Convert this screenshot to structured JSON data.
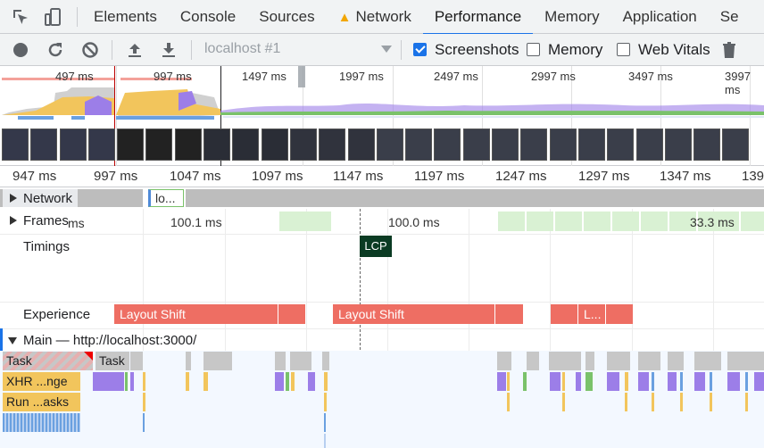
{
  "tabs": [
    {
      "label": "Elements"
    },
    {
      "label": "Console"
    },
    {
      "label": "Sources"
    },
    {
      "label": "Network",
      "warning": true
    },
    {
      "label": "Performance",
      "active": true
    },
    {
      "label": "Memory"
    },
    {
      "label": "Application"
    },
    {
      "label": "Se"
    }
  ],
  "toolbar": {
    "profile_select": "localhost #1",
    "screenshots_label": "Screenshots",
    "screenshots_checked": true,
    "memory_label": "Memory",
    "memory_checked": false,
    "web_vitals_label": "Web Vitals",
    "web_vitals_checked": false,
    "icons": [
      "record-icon",
      "reload-icon",
      "clear-icon",
      "upload-icon",
      "download-icon",
      "trash-icon"
    ]
  },
  "overview": {
    "ticks": [
      "497 ms",
      "997 ms",
      "1497 ms",
      "1997 ms",
      "2497 ms",
      "2997 ms",
      "3497 ms",
      "3997 ms"
    ]
  },
  "ruler": {
    "ticks": [
      "947 ms",
      "997 ms",
      "1047 ms",
      "1097 ms",
      "1147 ms",
      "1197 ms",
      "1247 ms",
      "1297 ms",
      "1347 ms",
      "139"
    ]
  },
  "tracks": {
    "network": "Network",
    "network_item": "lo...",
    "frames": "Frames",
    "frames_prefix": "ms",
    "frame_labels": [
      "100.1 ms",
      "100.0 ms",
      "33.3 ms"
    ],
    "timings": "Timings",
    "lcp": "LCP",
    "experience": "Experience",
    "layout_shifts": [
      "Layout Shift",
      "Layout Shift",
      "L..."
    ],
    "main": "Main — http://localhost:3000/",
    "tasks": [
      "Task",
      "Task"
    ],
    "xhr": "XHR ...nge",
    "run": "Run ...asks"
  },
  "colors": {
    "accent": "#1a73e8",
    "layout_shift": "#ee6e63",
    "lcp": "#0b3b23",
    "scripting": "#f2c55c",
    "rendering": "#9c7ee8",
    "painting": "#7ac26a",
    "idle": "#c4c4c4",
    "frame": "#d9f1d3"
  }
}
